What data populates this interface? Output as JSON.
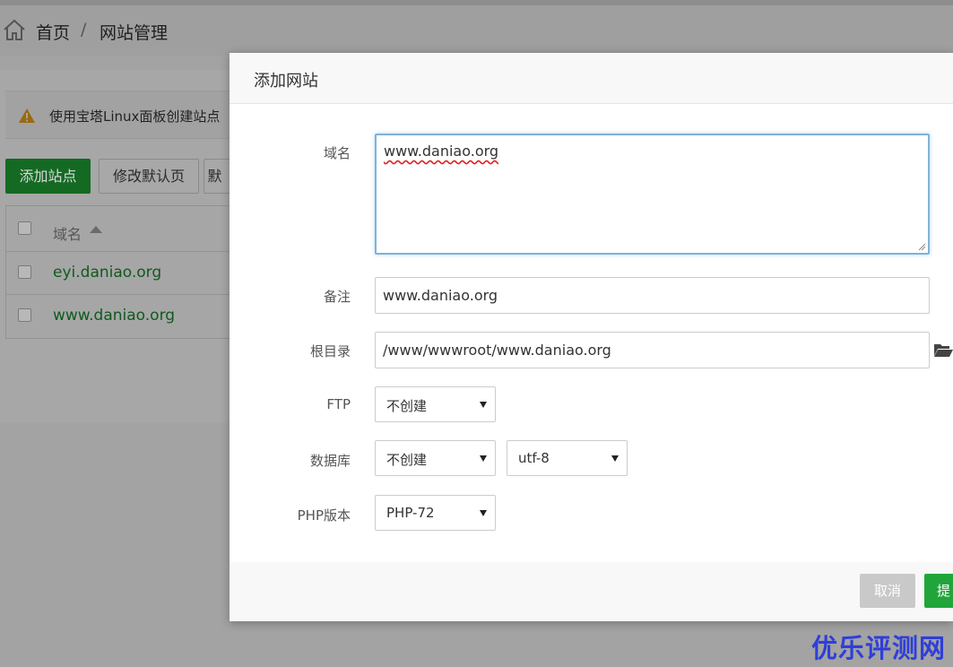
{
  "breadcrumb": {
    "home": "首页",
    "separator": "/",
    "current": "网站管理"
  },
  "alert": {
    "text": "使用宝塔Linux面板创建站点"
  },
  "toolbar": {
    "add_site": "添加站点",
    "edit_default_page": "修改默认页",
    "default_site_partial": "默"
  },
  "table": {
    "header": "域名",
    "rows": [
      {
        "domain": "eyi.daniao.org"
      },
      {
        "domain": "www.daniao.org"
      }
    ]
  },
  "modal": {
    "title": "添加网站",
    "fields": {
      "domain": {
        "label": "域名",
        "value": "www.daniao.org"
      },
      "remark": {
        "label": "备注",
        "value": "www.daniao.org"
      },
      "root": {
        "label": "根目录",
        "value": "/www/wwwroot/www.daniao.org"
      },
      "ftp": {
        "label": "FTP",
        "value": "不创建"
      },
      "database": {
        "label": "数据库",
        "value": "不创建",
        "charset": "utf-8"
      },
      "php": {
        "label": "PHP版本",
        "value": "PHP-72"
      }
    },
    "buttons": {
      "cancel": "取消",
      "submit": "提"
    }
  },
  "watermark": "优乐评测网",
  "colors": {
    "primary_green": "#20a53a",
    "link_green": "#0f5a1e",
    "watermark_blue": "#2f3fd8"
  }
}
